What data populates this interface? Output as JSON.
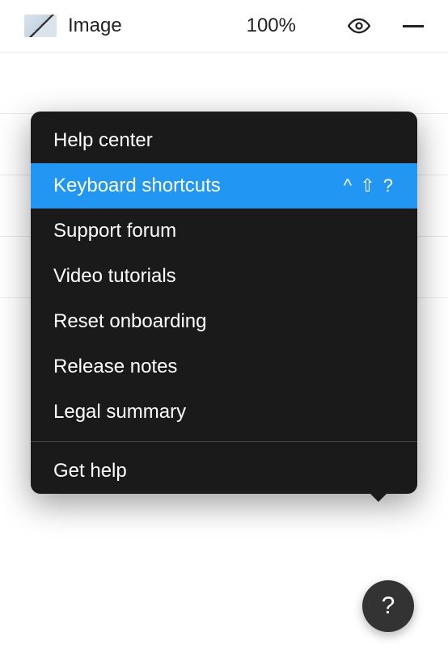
{
  "layer": {
    "name": "Image",
    "opacity": "100%"
  },
  "menu": {
    "items": [
      {
        "label": "Help center",
        "shortcut": ""
      },
      {
        "label": "Keyboard shortcuts",
        "shortcut": "^ ⇧ ?",
        "selected": true
      },
      {
        "label": "Support forum",
        "shortcut": ""
      },
      {
        "label": "Video tutorials",
        "shortcut": ""
      },
      {
        "label": "Reset onboarding",
        "shortcut": ""
      },
      {
        "label": "Release notes",
        "shortcut": ""
      },
      {
        "label": "Legal summary",
        "shortcut": ""
      }
    ],
    "footer": {
      "label": "Get help"
    }
  },
  "fab": {
    "label": "?"
  }
}
